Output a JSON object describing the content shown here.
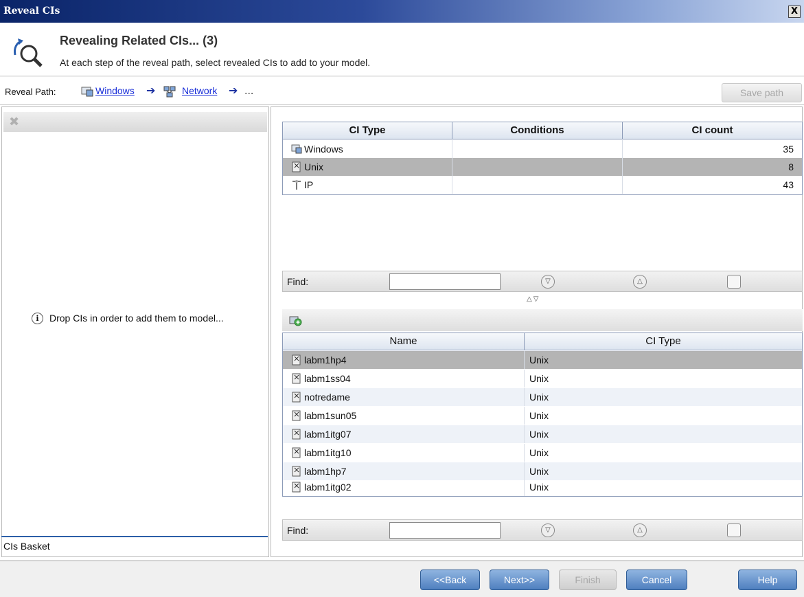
{
  "window": {
    "title": "Reveal CIs",
    "close_glyph": "X"
  },
  "header": {
    "title": "Revealing Related CIs... (3)",
    "subtitle": "At each step of the reveal path, select revealed CIs to add to your model."
  },
  "reveal_path": {
    "label": "Reveal Path:",
    "steps": [
      {
        "label": "Windows",
        "icon": "windows-ci-icon"
      },
      {
        "label": "Network",
        "icon": "network-ci-icon"
      }
    ],
    "more": "...",
    "save_label": "Save path"
  },
  "basket": {
    "drop_message": "Drop CIs in order to add them to model...",
    "info_glyph": "i",
    "label": "CIs Basket"
  },
  "ci_type_grid": {
    "columns": [
      "CI Type",
      "Conditions",
      "CI count"
    ],
    "rows": [
      {
        "type": "Windows",
        "conditions": "",
        "count": "35",
        "icon": "windows-ci-icon"
      },
      {
        "type": "Unix",
        "conditions": "",
        "count": "8",
        "icon": "unix-ci-icon"
      },
      {
        "type": "IP",
        "conditions": "",
        "count": "43",
        "icon": "ip-ci-icon"
      }
    ],
    "selected_index": 1
  },
  "find": {
    "label": "Find:"
  },
  "ci_grid": {
    "columns": [
      "Name",
      "CI Type"
    ],
    "rows": [
      {
        "name": "labm1hp4",
        "type": "Unix"
      },
      {
        "name": "labm1ss04",
        "type": "Unix"
      },
      {
        "name": "notredame",
        "type": "Unix"
      },
      {
        "name": "labm1sun05",
        "type": "Unix"
      },
      {
        "name": "labm1itg07",
        "type": "Unix"
      },
      {
        "name": "labm1itg10",
        "type": "Unix"
      },
      {
        "name": "labm1hp7",
        "type": "Unix"
      },
      {
        "name": "labm1itg02",
        "type": "Unix"
      }
    ],
    "selected_index": 0
  },
  "buttons": {
    "back": "<<Back",
    "next": "Next>>",
    "finish": "Finish",
    "cancel": "Cancel",
    "help": "Help"
  },
  "colors": {
    "title_bar": "#0a2468",
    "selection": "#b4b4b4",
    "link": "#1a2fd8",
    "button": "#4f7fbf"
  }
}
